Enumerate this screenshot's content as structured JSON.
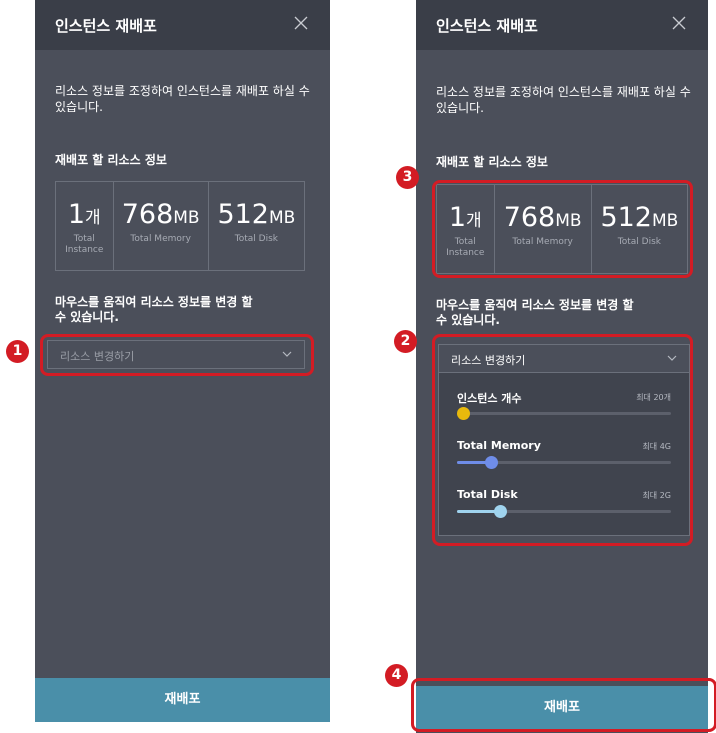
{
  "panels": [
    {
      "title": "인스턴스 재배포",
      "description": "리소스 정보를 조정하여 인스턴스를 재배포 하실 수 있습니다.",
      "resource_label": "재배포 할 리소스 정보",
      "stats": [
        {
          "value": "1",
          "unit": "개",
          "caption": "Total Instance"
        },
        {
          "value": "768",
          "unit": "MB",
          "caption": "Total Memory"
        },
        {
          "value": "512",
          "unit": "MB",
          "caption": "Total Disk"
        }
      ],
      "hint": "마우스를 움직여 리소스 정보를 변경 할 수 있습니다.",
      "select_placeholder": "리소스 변경하기",
      "submit_label": "재배포"
    },
    {
      "title": "인스턴스 재배포",
      "description": "리소스 정보를 조정하여 인스턴스를 재배포 하실 수 있습니다.",
      "resource_label": "재배포 할 리소스 정보",
      "stats": [
        {
          "value": "1",
          "unit": "개",
          "caption": "Total Instance"
        },
        {
          "value": "768",
          "unit": "MB",
          "caption": "Total Memory"
        },
        {
          "value": "512",
          "unit": "MB",
          "caption": "Total Disk"
        }
      ],
      "hint": "마우스를 움직여 리소스 정보를 변경 할 수 있습니다.",
      "select_value": "리소스 변경하기",
      "sliders": [
        {
          "label": "인스턴스 개수",
          "max": "최대 20개",
          "fraction": 0.0,
          "color": "#e8b90c"
        },
        {
          "label": "Total Memory",
          "max": "최대 4G",
          "fraction": 0.16,
          "color": "#6f8de8"
        },
        {
          "label": "Total Disk",
          "max": "최대 2G",
          "fraction": 0.2,
          "color": "#9fd3ee"
        }
      ],
      "submit_label": "재배포"
    }
  ],
  "annotations": [
    "1",
    "2",
    "3",
    "4"
  ],
  "colors": {
    "panel": "#4b4f5a",
    "header": "#3a3e48",
    "button": "#4a8fa9",
    "highlight": "#d31c24"
  }
}
